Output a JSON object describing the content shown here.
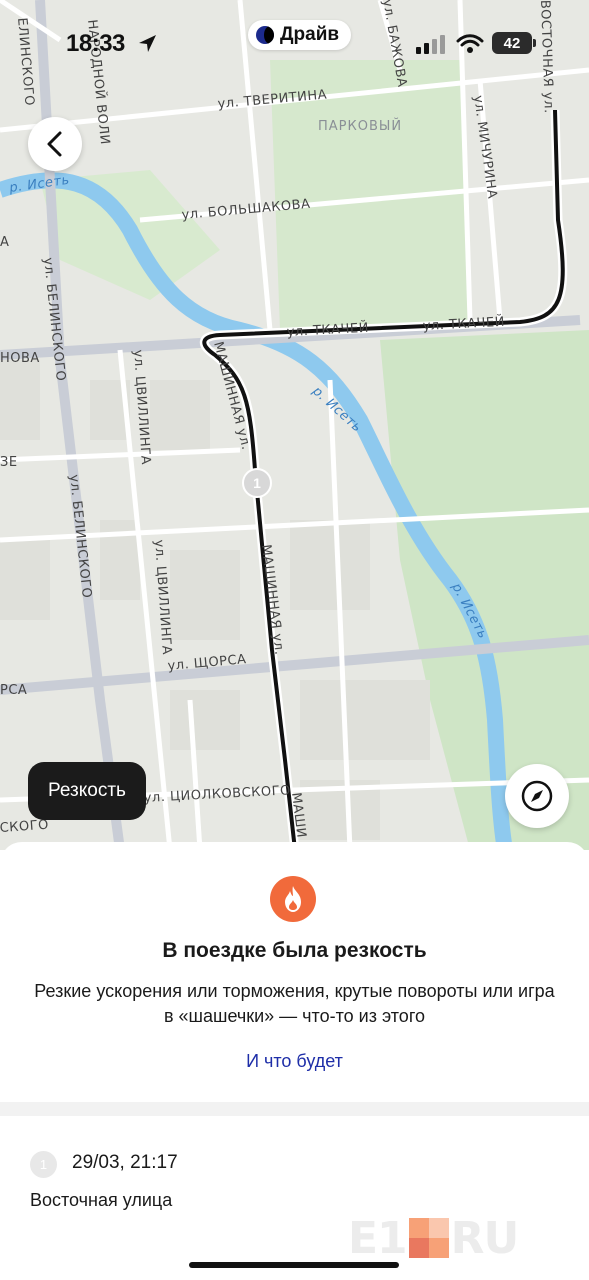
{
  "status_bar": {
    "time": "18:33",
    "app_pill_label": "Драйв",
    "battery_level": "42",
    "icons": [
      "location-arrow-icon",
      "cellular-signal-icon",
      "wifi-icon",
      "battery-icon"
    ]
  },
  "map": {
    "district": "ПАРКОВЫЙ",
    "streets": {
      "tveritina": "ул. ТВЕРИТИНА",
      "bolshakova": "ул. БОЛЬШАКОВА",
      "tkachei_1": "ул. ТКАЧЕЙ",
      "tkachei_2": "ул. ТКАЧЕЙ",
      "mashinnaya_1": "МАШИННАЯ ул.",
      "mashinnaya_2": "МАШИННАЯ ул.",
      "mashinnaya_3": "МАШИ",
      "belinskogo_1": "ЕЛИНСКОГО",
      "belinskogo_2": "ул. БЕЛИНСКОГО",
      "belinskogo_3": "ул. БЕЛИНСКОГО",
      "tsvillinga_1": "ул. ЦВИЛЛИНГА",
      "tsvillinga_2": "ул. ЦВИЛЛИНГА",
      "shchorsa": "ул. ЩОРСА",
      "tsiolkovskogo": "ул. ЦИОЛКОВСКОГО",
      "michurina": "ул. МИЧУРИНА",
      "vostochnaya": "ВОСТОЧНАЯ ул.",
      "bazhova": "ул. БАЖОВА",
      "novaya": "НОВА",
      "left_a": "А",
      "left_ze": "ЗЕ",
      "left_rsa": "РСА",
      "left_skogo": "СКОГО",
      "narod": "НАРОДНОЙ ВОЛИ",
      "river_1": "р. Исеть",
      "river_2": "р. Исеть",
      "river_3": "р. Исеть"
    },
    "route_point_number": "1",
    "colors": {
      "background": "#e7e8e3",
      "park": "#cfe5c6",
      "river": "#8ec9ee",
      "road": "#ffffff",
      "major_road": "#c9cdd6",
      "route": "#111111"
    }
  },
  "controls": {
    "back_icon": "chevron-left-icon",
    "compass_icon": "compass-icon",
    "filter_chip_label": "Резкость"
  },
  "sheet": {
    "icon": "fire-icon",
    "title": "В поездке была резкость",
    "description": "Резкие ускорения или торможения, крутые повороты или игра в «шашечки» — что-то из этого",
    "link": "И что будет",
    "event": {
      "number": "1",
      "datetime": "29/03, 21:17",
      "street": "Восточная улица"
    }
  },
  "watermark": {
    "left": "E1",
    "right": "RU"
  }
}
